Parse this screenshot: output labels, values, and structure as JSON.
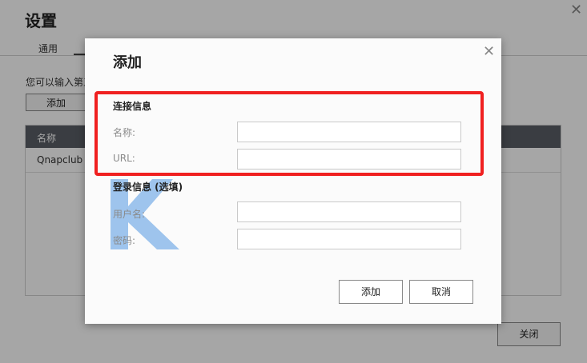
{
  "background": {
    "title": "设置",
    "tabs": [
      {
        "label": "通用"
      }
    ],
    "description": "您可以输入第三",
    "add_label": "添加",
    "table": {
      "header": "名称",
      "rows": [
        {
          "name": "Qnapclub"
        }
      ]
    },
    "close_label": "关闭"
  },
  "dialog": {
    "title": "添加",
    "close_icon": "close-icon",
    "connection_section": "连接信息",
    "name_label": "名称:",
    "name_value": "",
    "url_label": "URL:",
    "url_value": "",
    "login_section": "登录信息 (选填)",
    "username_label": "用户名:",
    "username_value": "",
    "password_label": "密码:",
    "password_value": "",
    "add_label": "添加",
    "cancel_label": "取消"
  },
  "colors": {
    "highlight": "#f02020",
    "watermark": "#7fb1e8",
    "table_header": "#5a5f66"
  }
}
